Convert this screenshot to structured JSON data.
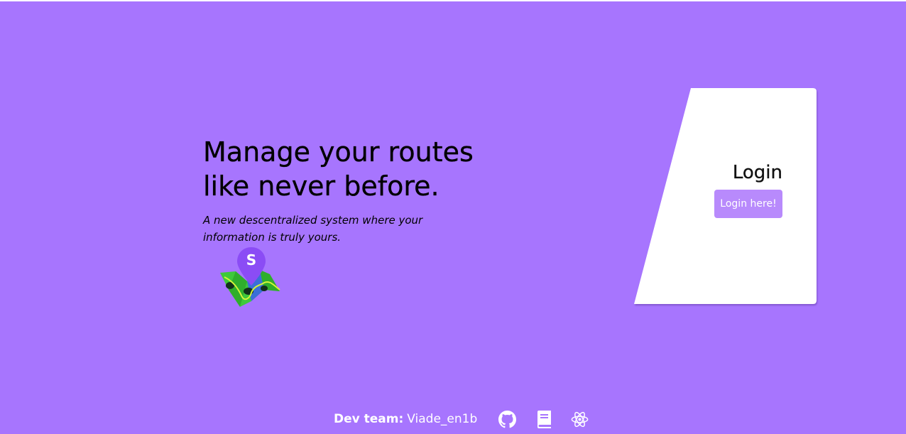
{
  "hero": {
    "title_line1": "Manage your routes",
    "title_line2": "like never before.",
    "subtitle": "A new descentralized system where your information is truly yours."
  },
  "login": {
    "title": "Login",
    "button_label": "Login here!"
  },
  "footer": {
    "dev_team_label": "Dev team:",
    "dev_team_name": "Viade_en1b",
    "icons": [
      "github-icon",
      "book-icon",
      "react-icon"
    ]
  },
  "colors": {
    "background": "#a775fe",
    "card": "#ffffff",
    "button": "#b88afc",
    "logo_pin": "#8b4cf5",
    "logo_map_green": "#3ec93a",
    "logo_map_blue": "#3a6fd8"
  },
  "logo": {
    "pin_letter": "S"
  }
}
